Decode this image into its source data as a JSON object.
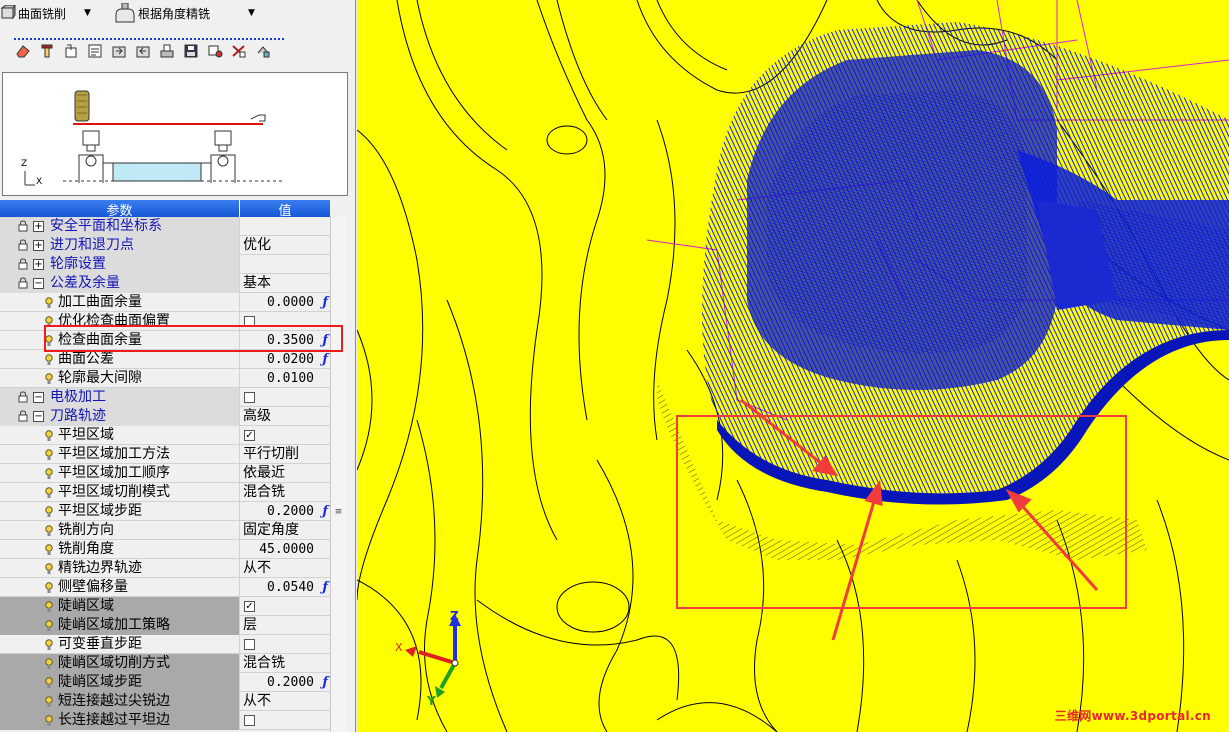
{
  "toolbar": {
    "method": "曲面铣削",
    "strategy": "根据角度精铣"
  },
  "toolbar_icons": [
    "eraser-icon",
    "tool-icon",
    "hand-icon",
    "properties-icon",
    "export-icon",
    "import-icon",
    "fixture-icon",
    "save-icon",
    "settings-icon",
    "key-icon",
    "sync-icon"
  ],
  "preview": {
    "axis_z": "Z",
    "axis_x": "X"
  },
  "grid": {
    "header_param": "参数",
    "header_value": "值",
    "rows": [
      {
        "type": "group",
        "label": "安全平面和坐标系",
        "expanded": false,
        "value": "",
        "kind": "text"
      },
      {
        "type": "group",
        "label": "进刀和退刀点",
        "expanded": false,
        "value": "优化",
        "kind": "text"
      },
      {
        "type": "group",
        "label": "轮廓设置",
        "expanded": false,
        "value": "",
        "kind": "text"
      },
      {
        "type": "group",
        "label": "公差及余量",
        "expanded": true,
        "value": "基本",
        "kind": "text"
      },
      {
        "type": "child",
        "label": "加工曲面余量",
        "value": "0.0000",
        "kind": "fnum"
      },
      {
        "type": "child",
        "label": "优化检查曲面偏置",
        "value": "",
        "kind": "check",
        "checked": false
      },
      {
        "type": "child",
        "label": "检查曲面余量",
        "value": "0.3500",
        "kind": "fnum"
      },
      {
        "type": "child",
        "label": "曲面公差",
        "value": "0.0200",
        "kind": "fnum"
      },
      {
        "type": "child",
        "label": "轮廓最大间隙",
        "value": "0.0100",
        "kind": "num"
      },
      {
        "type": "group",
        "label": "电极加工",
        "expanded": true,
        "value": "",
        "kind": "check",
        "checked": false
      },
      {
        "type": "group",
        "label": "刀路轨迹",
        "expanded": true,
        "value": "高级",
        "kind": "text"
      },
      {
        "type": "child",
        "label": "平坦区域",
        "value": "",
        "kind": "check",
        "checked": true
      },
      {
        "type": "child",
        "label": "平坦区域加工方法",
        "value": "平行切削",
        "kind": "text"
      },
      {
        "type": "child",
        "label": "平坦区域加工顺序",
        "value": "依最近",
        "kind": "text"
      },
      {
        "type": "child",
        "label": "平坦区域切削模式",
        "value": "混合铣",
        "kind": "text"
      },
      {
        "type": "child",
        "label": "平坦区域步距",
        "value": "0.2000",
        "kind": "fnum"
      },
      {
        "type": "child",
        "label": "铣削方向",
        "value": "固定角度",
        "kind": "text"
      },
      {
        "type": "child",
        "label": "铣削角度",
        "value": "45.0000",
        "kind": "num"
      },
      {
        "type": "child",
        "label": "精铣边界轨迹",
        "value": "从不",
        "kind": "text"
      },
      {
        "type": "child",
        "label": "侧壁偏移量",
        "value": "0.0540",
        "kind": "fnum"
      },
      {
        "type": "child",
        "label": "陡峭区域",
        "value": "",
        "kind": "check",
        "checked": true,
        "dark": true
      },
      {
        "type": "child",
        "label": "陡峭区域加工策略",
        "value": "层",
        "kind": "text",
        "dark": true
      },
      {
        "type": "child",
        "label": "可变垂直步距",
        "value": "",
        "kind": "check",
        "checked": false
      },
      {
        "type": "child",
        "label": "陡峭区域切削方式",
        "value": "混合铣",
        "kind": "text",
        "dark": true
      },
      {
        "type": "child",
        "label": "陡峭区域步距",
        "value": "0.2000",
        "kind": "fnum",
        "dark": true
      },
      {
        "type": "child",
        "label": "短连接越过尖锐边",
        "value": "从不",
        "kind": "text",
        "dark": true
      },
      {
        "type": "child",
        "label": "长连接越过平坦边",
        "value": "",
        "kind": "check",
        "checked": false,
        "dark": true
      }
    ]
  },
  "viewport": {
    "axis_z": "Z",
    "axis_x": "X",
    "axis_y": "Y",
    "watermark": "三维网www.3dportal.cn",
    "colors": {
      "surface": "#ffff00",
      "toolpath": "#0b1bf0",
      "annotation": "#f03c3c",
      "wire": "#000000",
      "boundary": "#e020c8"
    }
  }
}
